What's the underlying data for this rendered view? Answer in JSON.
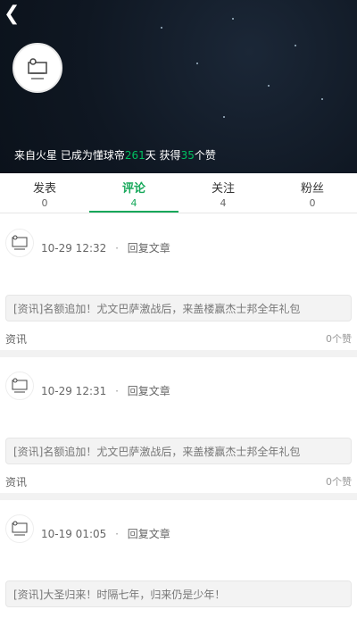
{
  "header": {
    "back_icon": "back-arrow-icon",
    "avatar_label": "avatar",
    "summary_prefix": "来自火星 已成为懂球帝",
    "days": "261",
    "summary_mid": "天 获得",
    "likes": "35",
    "summary_suffix": "个赞",
    "highlight_color": "#00c060"
  },
  "tabs": [
    {
      "label": "发表",
      "count": "0"
    },
    {
      "label": "评论",
      "count": "4"
    },
    {
      "label": "关注",
      "count": "4"
    },
    {
      "label": "粉丝",
      "count": "0"
    }
  ],
  "feed": [
    {
      "time": "10-29 12:32",
      "action": "回复文章",
      "snippet": "[资讯]名额追加！尤文巴萨激战后，来盖楼赢杰士邦全年礼包",
      "category": "资讯",
      "likes": "0个赞"
    },
    {
      "time": "10-29 12:31",
      "action": "回复文章",
      "snippet": "[资讯]名额追加！尤文巴萨激战后，来盖楼赢杰士邦全年礼包",
      "category": "资讯",
      "likes": "0个赞"
    },
    {
      "time": "10-19 01:05",
      "action": "回复文章",
      "snippet": "[资讯]大圣归来！时隔七年，归来仍是少年！"
    }
  ]
}
